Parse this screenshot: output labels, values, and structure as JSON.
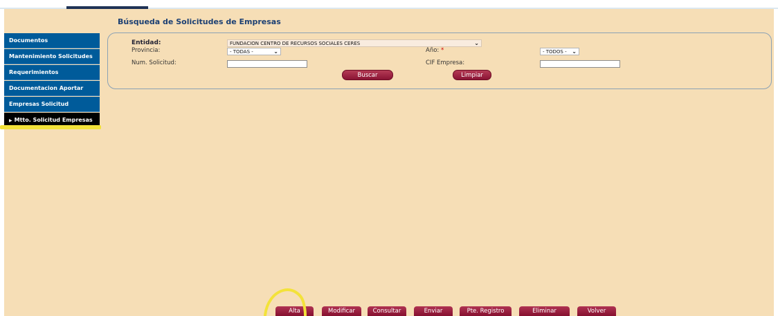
{
  "page_title": "Búsqueda de Solicitudes de Empresas",
  "sidebar": {
    "items": [
      {
        "label": "Documentos"
      },
      {
        "label": "Mantenimiento Solicitudes"
      },
      {
        "label": "Requerimientos"
      },
      {
        "label": "Documentacion Aportar"
      },
      {
        "label": "Empresas Solicitud"
      },
      {
        "label": "Mtto. Solicitud Empresas",
        "active": true
      }
    ]
  },
  "form": {
    "entidad_label": "Entidad:",
    "entidad_value": "FUNDACION CENTRO DE RECURSOS SOCIALES CERES",
    "provincia_label": "Provincia:",
    "provincia_value": "- TODAS -",
    "anio_label": "Año:",
    "anio_required": "*",
    "anio_value": "- TODOS -",
    "num_solicitud_label": "Num. Solicitud:",
    "num_solicitud_value": "",
    "cif_label": "CIF Empresa:",
    "cif_value": "",
    "buscar_label": "Buscar",
    "limpiar_label": "Limpiar"
  },
  "actions": {
    "alta": "Alta",
    "modificar": "Modificar",
    "consultar": "Consultar",
    "enviar": "Enviar",
    "pte_registro": "Pte. Registro",
    "eliminar": "Eliminar",
    "volver": "Volver"
  },
  "colors": {
    "page_bg": "#f6deb6",
    "sidebar_bg": "#005b9a",
    "sidebar_active": "#000000",
    "button": "#9b1f3f",
    "annotation": "#f3e23a"
  }
}
